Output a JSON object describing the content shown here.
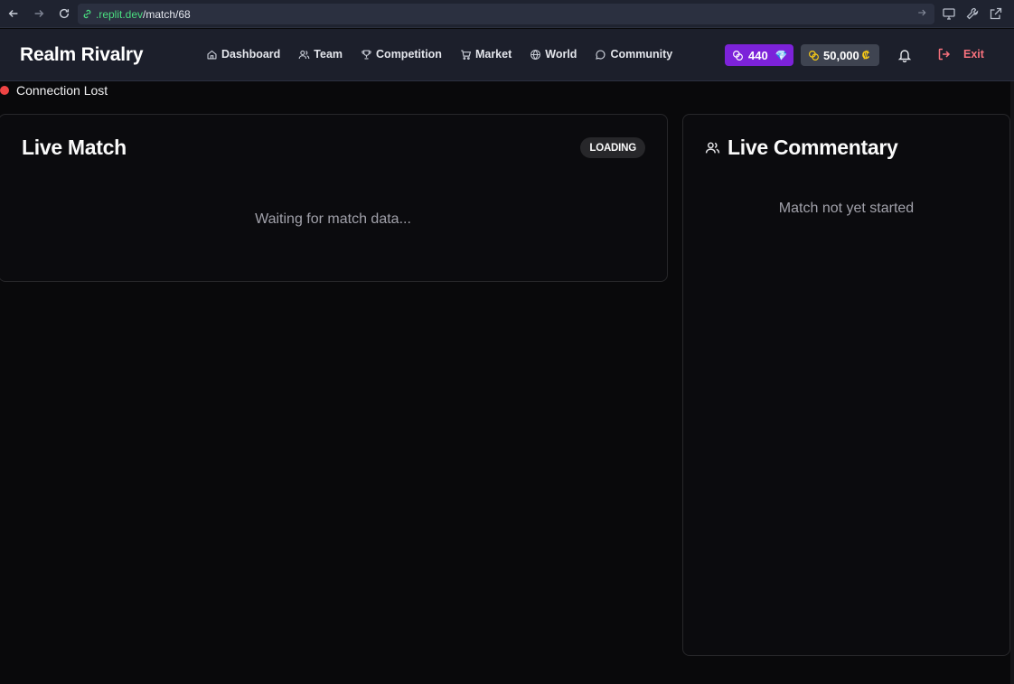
{
  "browser": {
    "url_domain": ".replit.dev",
    "url_path": "/match/68",
    "icons": [
      "back-icon",
      "forward-icon",
      "reload-icon",
      "link-icon",
      "go-arrow-icon",
      "monitor-icon",
      "wrench-icon",
      "external-link-icon"
    ]
  },
  "header": {
    "brand": "Realm Rivalry",
    "nav": [
      {
        "label": "Dashboard",
        "icon": "home-icon"
      },
      {
        "label": "Team",
        "icon": "users-icon"
      },
      {
        "label": "Competition",
        "icon": "trophy-icon"
      },
      {
        "label": "Market",
        "icon": "cart-icon"
      },
      {
        "label": "World",
        "icon": "globe-icon"
      },
      {
        "label": "Community",
        "icon": "chat-icon"
      }
    ],
    "gems": "440",
    "gem_symbol": "💎",
    "coins": "50,000",
    "coin_symbol": "₡",
    "exit_label": "Exit"
  },
  "status": {
    "connection": "Connection Lost",
    "color": "#ef4444"
  },
  "match": {
    "title": "Live Match",
    "badge": "LOADING",
    "message": "Waiting for match data..."
  },
  "commentary": {
    "title": "Live Commentary",
    "message": "Match not yet started"
  },
  "colors": {
    "accent_purple": "#7c22d9",
    "coin_gold": "#facc15",
    "exit_red": "#f8717d",
    "background": "#09090b"
  }
}
